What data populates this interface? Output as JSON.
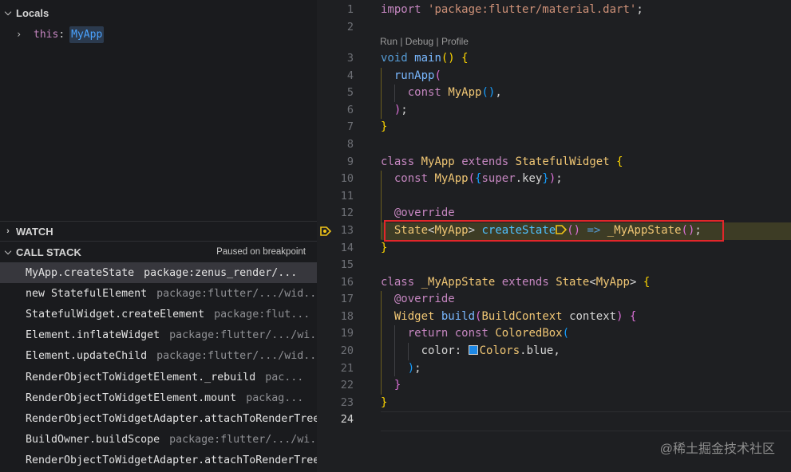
{
  "sidebar": {
    "locals": {
      "title": "Locals",
      "var_name": "this",
      "var_value": "MyApp"
    },
    "watch": {
      "title": "WATCH"
    },
    "call_stack": {
      "title": "CALL STACK",
      "status": "Paused on breakpoint",
      "frames": [
        {
          "fn": "MyApp.createState",
          "src": "package:zenus_render/..."
        },
        {
          "fn": "new StatefulElement",
          "src": "package:flutter/.../wid..."
        },
        {
          "fn": "StatefulWidget.createElement",
          "src": "package:flut..."
        },
        {
          "fn": "Element.inflateWidget",
          "src": "package:flutter/.../wi..."
        },
        {
          "fn": "Element.updateChild",
          "src": "package:flutter/.../wid..."
        },
        {
          "fn": "RenderObjectToWidgetElement._rebuild",
          "src": "pac..."
        },
        {
          "fn": "RenderObjectToWidgetElement.mount",
          "src": "packag..."
        },
        {
          "fn": "RenderObjectToWidgetAdapter.attachToRenderTree",
          "src": ""
        },
        {
          "fn": "BuildOwner.buildScope",
          "src": "package:flutter/.../wi..."
        },
        {
          "fn": "RenderObjectToWidgetAdapter.attachToRenderTree",
          "src": ""
        }
      ]
    }
  },
  "editor": {
    "codelens": "Run | Debug | Profile",
    "line_numbers": [
      "1",
      "2",
      "3",
      "4",
      "5",
      "6",
      "7",
      "8",
      "9",
      "10",
      "11",
      "12",
      "13",
      "14",
      "15",
      "16",
      "17",
      "18",
      "19",
      "20",
      "21",
      "22",
      "23",
      "24"
    ],
    "current_line": "24",
    "breakpoint_line": "13",
    "code": {
      "l1_kw": "import",
      "l1_str": "'package:flutter/material.dart'",
      "l1_end": ";",
      "l3_kw": "void",
      "l3_fn": "main",
      "l4_fn": "runApp",
      "l5_kw": "const",
      "l5_ty": "MyApp",
      "l9_kw": "class",
      "l9_ty": "MyApp",
      "l9_kw2": "extends",
      "l9_ty2": "StatefulWidget",
      "l10_kw": "const",
      "l10_ty": "MyApp",
      "l10_super": "super",
      "l10_key": "key",
      "l12_ann": "@override",
      "l13_ty": "State",
      "l13_ty2": "MyApp",
      "l13_fn": "createState",
      "l13_arrow": "=>",
      "l13_ty3": "_MyAppState",
      "l16_kw": "class",
      "l16_ty": "_MyAppState",
      "l16_kw2": "extends",
      "l16_ty2": "State",
      "l16_ty3": "MyApp",
      "l17_ann": "@override",
      "l18_ty": "Widget",
      "l18_fn": "build",
      "l18_ty2": "BuildContext",
      "l18_var": "context",
      "l19_kw": "return",
      "l19_kw2": "const",
      "l19_ty": "ColoredBox",
      "l20_prop": "color:",
      "l20_ty": "Colors",
      "l20_val": "blue"
    }
  },
  "watermark": "@稀土掘金技术社区",
  "colors": {
    "breakpoint": "#f0c419",
    "highlight_box": "#e2262a"
  }
}
